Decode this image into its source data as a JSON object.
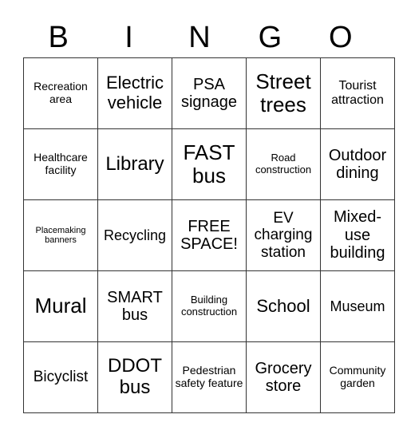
{
  "header": [
    "B",
    "I",
    "N",
    "G",
    "O"
  ],
  "rows": [
    [
      "Recreation area",
      "Electric vehicle",
      "PSA signage",
      "Street trees",
      "Tourist attraction"
    ],
    [
      "Healthcare facility",
      "Library",
      "FAST bus",
      "Road construction",
      "Outdoor dining"
    ],
    [
      "Placemaking banners",
      "Recycling",
      "FREE SPACE!",
      "EV charging station",
      "Mixed-use building"
    ],
    [
      "Mural",
      "SMART bus",
      "Building construction",
      "School",
      "Museum"
    ],
    [
      "Bicyclist",
      "DDOT bus",
      "Pedestrian safety feature",
      "Grocery store",
      "Community garden"
    ]
  ]
}
